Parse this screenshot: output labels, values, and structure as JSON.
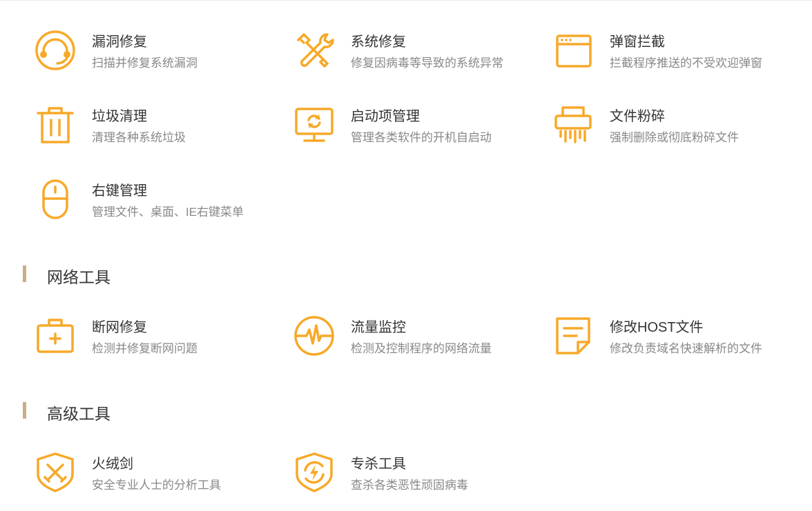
{
  "accent_color": "#f7a929",
  "section_bar_color": "#c8ad86",
  "system_tools": [
    {
      "title": "漏洞修复",
      "desc": "扫描并修复系统漏洞",
      "icon": "headset-icon"
    },
    {
      "title": "系统修复",
      "desc": "修复因病毒等导致的系统异常",
      "icon": "wrench-screwdriver-icon"
    },
    {
      "title": "弹窗拦截",
      "desc": "拦截程序推送的不受欢迎弹窗",
      "icon": "browser-window-icon"
    },
    {
      "title": "垃圾清理",
      "desc": "清理各种系统垃圾",
      "icon": "trash-icon"
    },
    {
      "title": "启动项管理",
      "desc": "管理各类软件的开机自启动",
      "icon": "monitor-refresh-icon"
    },
    {
      "title": "文件粉碎",
      "desc": "强制删除或彻底粉碎文件",
      "icon": "shredder-icon"
    },
    {
      "title": "右键管理",
      "desc": "管理文件、桌面、IE右键菜单",
      "icon": "mouse-icon"
    }
  ],
  "network_section": {
    "title": "网络工具",
    "tools": [
      {
        "title": "断网修复",
        "desc": "检测并修复断网问题",
        "icon": "first-aid-kit-icon"
      },
      {
        "title": "流量监控",
        "desc": "检测及控制程序的网络流量",
        "icon": "pulse-icon"
      },
      {
        "title": "修改HOST文件",
        "desc": "修改负责域名快速解析的文件",
        "icon": "note-document-icon"
      }
    ]
  },
  "advanced_section": {
    "title": "高级工具",
    "tools": [
      {
        "title": "火绒剑",
        "desc": "安全专业人士的分析工具",
        "icon": "shield-swords-icon"
      },
      {
        "title": "专杀工具",
        "desc": "查杀各类恶性顽固病毒",
        "icon": "shield-bolt-icon"
      }
    ]
  }
}
